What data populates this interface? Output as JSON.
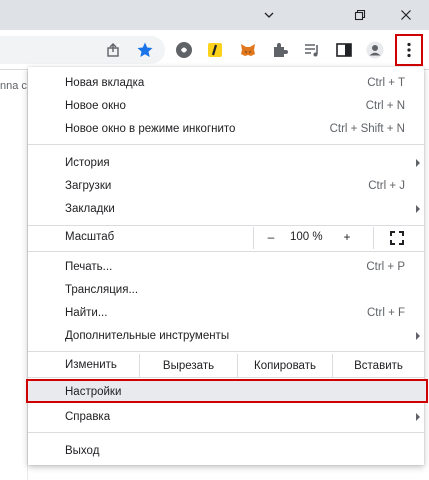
{
  "page": {
    "snippet": "nna c"
  },
  "toolbar": {
    "icons": [
      "share-icon",
      "star-icon",
      "ext-circle-icon",
      "ext-yellow-icon",
      "metamask-icon",
      "puzzle-icon",
      "media-queue-icon",
      "sidepanel-icon",
      "avatar-icon",
      "kebab-menu-icon"
    ],
    "accent": "#1a73e8",
    "highlight_color": "#d00000"
  },
  "menu": {
    "new_tab": {
      "label": "Новая вкладка",
      "shortcut": "Ctrl + T"
    },
    "new_window": {
      "label": "Новое окно",
      "shortcut": "Ctrl + N"
    },
    "incognito": {
      "label": "Новое окно в режиме инкогнито",
      "shortcut": "Ctrl + Shift + N"
    },
    "history": {
      "label": "История"
    },
    "downloads": {
      "label": "Загрузки",
      "shortcut": "Ctrl + J"
    },
    "bookmarks": {
      "label": "Закладки"
    },
    "zoom": {
      "label": "Масштаб",
      "minus": "–",
      "value": "100 %",
      "plus": "+"
    },
    "print": {
      "label": "Печать...",
      "shortcut": "Ctrl + P"
    },
    "cast": {
      "label": "Трансляция..."
    },
    "find": {
      "label": "Найти...",
      "shortcut": "Ctrl + F"
    },
    "more_tools": {
      "label": "Дополнительные инструменты"
    },
    "edit": {
      "label": "Изменить",
      "cut": "Вырезать",
      "copy": "Копировать",
      "paste": "Вставить"
    },
    "settings": {
      "label": "Настройки"
    },
    "help": {
      "label": "Справка"
    },
    "exit": {
      "label": "Выход"
    }
  }
}
